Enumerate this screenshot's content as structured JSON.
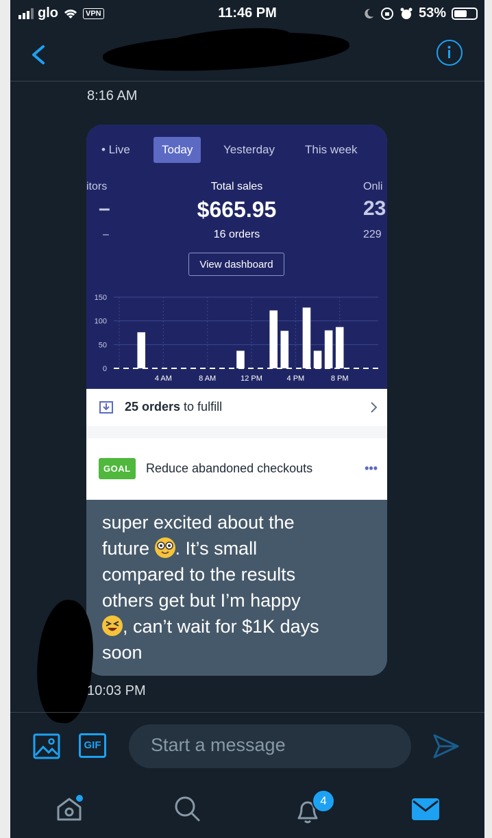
{
  "status_bar": {
    "carrier": "glo",
    "vpn": "VPN",
    "time": "11:46 PM",
    "battery": "53%",
    "battery_level": 0.53
  },
  "conversation": {
    "sent_time": "8:16 AM",
    "received_time": "10:03 PM"
  },
  "dashboard": {
    "tabs": [
      {
        "label": "• Live",
        "active": false
      },
      {
        "label": "Today",
        "active": true
      },
      {
        "label": "Yesterday",
        "active": false
      },
      {
        "label": "This week",
        "active": false
      }
    ],
    "left_metric_label": "itors",
    "left_metric_value": "–",
    "left_metric_sub": "–",
    "total_sales_label": "Total sales",
    "total_sales_value": "$665.95",
    "orders": "16 orders",
    "right_metric_label": "Onli",
    "right_metric_value": "23",
    "right_metric_sub": "229",
    "view_dashboard": "View dashboard",
    "fulfill_count": "25 orders",
    "fulfill_suffix": " to fulfill",
    "goal_badge": "GOAL",
    "goal_text": "Reduce abandoned checkouts",
    "more_dots": "•••"
  },
  "chart_data": {
    "type": "bar",
    "y_ticks": [
      "150",
      "100",
      "50",
      "0"
    ],
    "ylim": [
      0,
      150
    ],
    "x_tick_labels": [
      "4 AM",
      "8 AM",
      "12 PM",
      "4 PM",
      "8 PM"
    ],
    "hours": [
      0,
      1,
      2,
      3,
      4,
      5,
      6,
      7,
      8,
      9,
      10,
      11,
      12,
      13,
      14,
      15,
      16,
      17,
      18,
      19,
      20,
      21,
      22,
      23
    ],
    "values": [
      0,
      0,
      76,
      0,
      0,
      0,
      0,
      0,
      0,
      0,
      0,
      37,
      0,
      0,
      122,
      79,
      0,
      128,
      37,
      80,
      87,
      0,
      0,
      0
    ],
    "grid": true
  },
  "message": {
    "line1": "super excited about the",
    "line2a": "future ",
    "line2b": ". It’s small",
    "line3": "compared to the results",
    "line4": "others get but I’m happy",
    "line5b": ", can’t wait for $1K days",
    "line6": "soon"
  },
  "composer": {
    "placeholder": "Start a message",
    "gif_label": "GIF"
  },
  "tabbar": {
    "notifications_count": "4"
  },
  "colors": {
    "background": "#15202b",
    "accent": "#1da1f2",
    "shopify_navy": "#1f2564",
    "goal_green": "#50b83c"
  }
}
